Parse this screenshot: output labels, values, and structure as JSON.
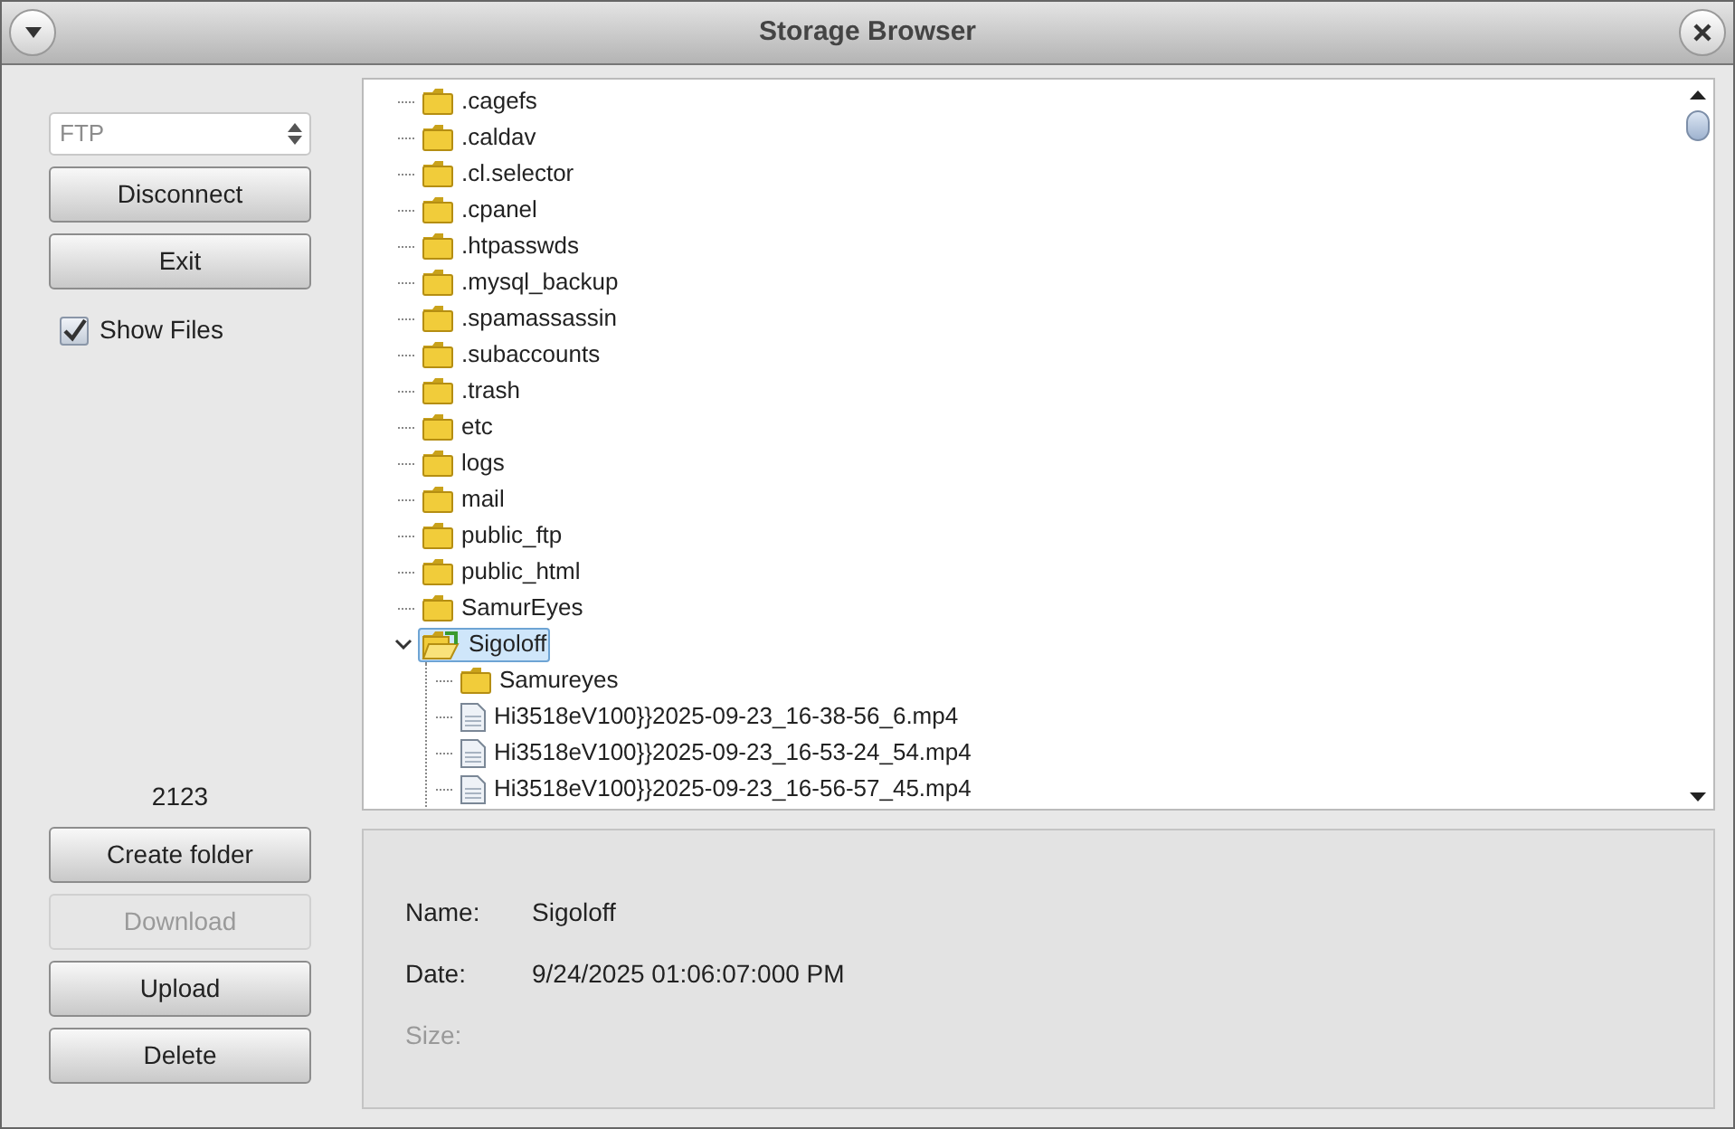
{
  "window": {
    "title": "Storage Browser"
  },
  "protocol": {
    "value": "FTP",
    "disabled": true
  },
  "top_buttons": [
    {
      "label": "Disconnect",
      "disabled": false
    },
    {
      "label": "Exit",
      "disabled": false
    }
  ],
  "show_files": {
    "label": "Show Files",
    "checked": true
  },
  "count": "2123",
  "bottom_buttons": [
    {
      "label": "Create folder",
      "disabled": false
    },
    {
      "label": "Download",
      "disabled": true
    },
    {
      "label": "Upload",
      "disabled": false
    },
    {
      "label": "Delete",
      "disabled": false
    }
  ],
  "tree": [
    {
      "kind": "folder",
      "label": ".cagefs",
      "selected": false
    },
    {
      "kind": "folder",
      "label": ".caldav",
      "selected": false
    },
    {
      "kind": "folder",
      "label": ".cl.selector",
      "selected": false
    },
    {
      "kind": "folder",
      "label": ".cpanel",
      "selected": false
    },
    {
      "kind": "folder",
      "label": ".htpasswds",
      "selected": false
    },
    {
      "kind": "folder",
      "label": ".mysql_backup",
      "selected": false
    },
    {
      "kind": "folder",
      "label": ".spamassassin",
      "selected": false
    },
    {
      "kind": "folder",
      "label": ".subaccounts",
      "selected": false
    },
    {
      "kind": "folder",
      "label": ".trash",
      "selected": false
    },
    {
      "kind": "folder",
      "label": "etc",
      "selected": false
    },
    {
      "kind": "folder",
      "label": "logs",
      "selected": false
    },
    {
      "kind": "folder",
      "label": "mail",
      "selected": false
    },
    {
      "kind": "folder",
      "label": "public_ftp",
      "selected": false
    },
    {
      "kind": "folder",
      "label": "public_html",
      "selected": false
    },
    {
      "kind": "folder",
      "label": "SamurEyes",
      "selected": false
    },
    {
      "kind": "folder",
      "label": "Sigoloff",
      "selected": true,
      "expanded": true,
      "children": [
        {
          "kind": "folder",
          "label": "Samureyes",
          "selected": false
        },
        {
          "kind": "file",
          "label": "Hi3518eV100}}2025-09-23_16-38-56_6.mp4",
          "selected": false
        },
        {
          "kind": "file",
          "label": "Hi3518eV100}}2025-09-23_16-53-24_54.mp4",
          "selected": false
        },
        {
          "kind": "file",
          "label": "Hi3518eV100}}2025-09-23_16-56-57_45.mp4",
          "selected": false
        }
      ]
    }
  ],
  "details": [
    {
      "label": "Name:",
      "value": "Sigoloff",
      "disabled": false
    },
    {
      "label": "Date:",
      "value": "9/24/2025 01:06:07:000 PM",
      "disabled": false
    },
    {
      "label": "Size:",
      "disabled": true
    }
  ]
}
